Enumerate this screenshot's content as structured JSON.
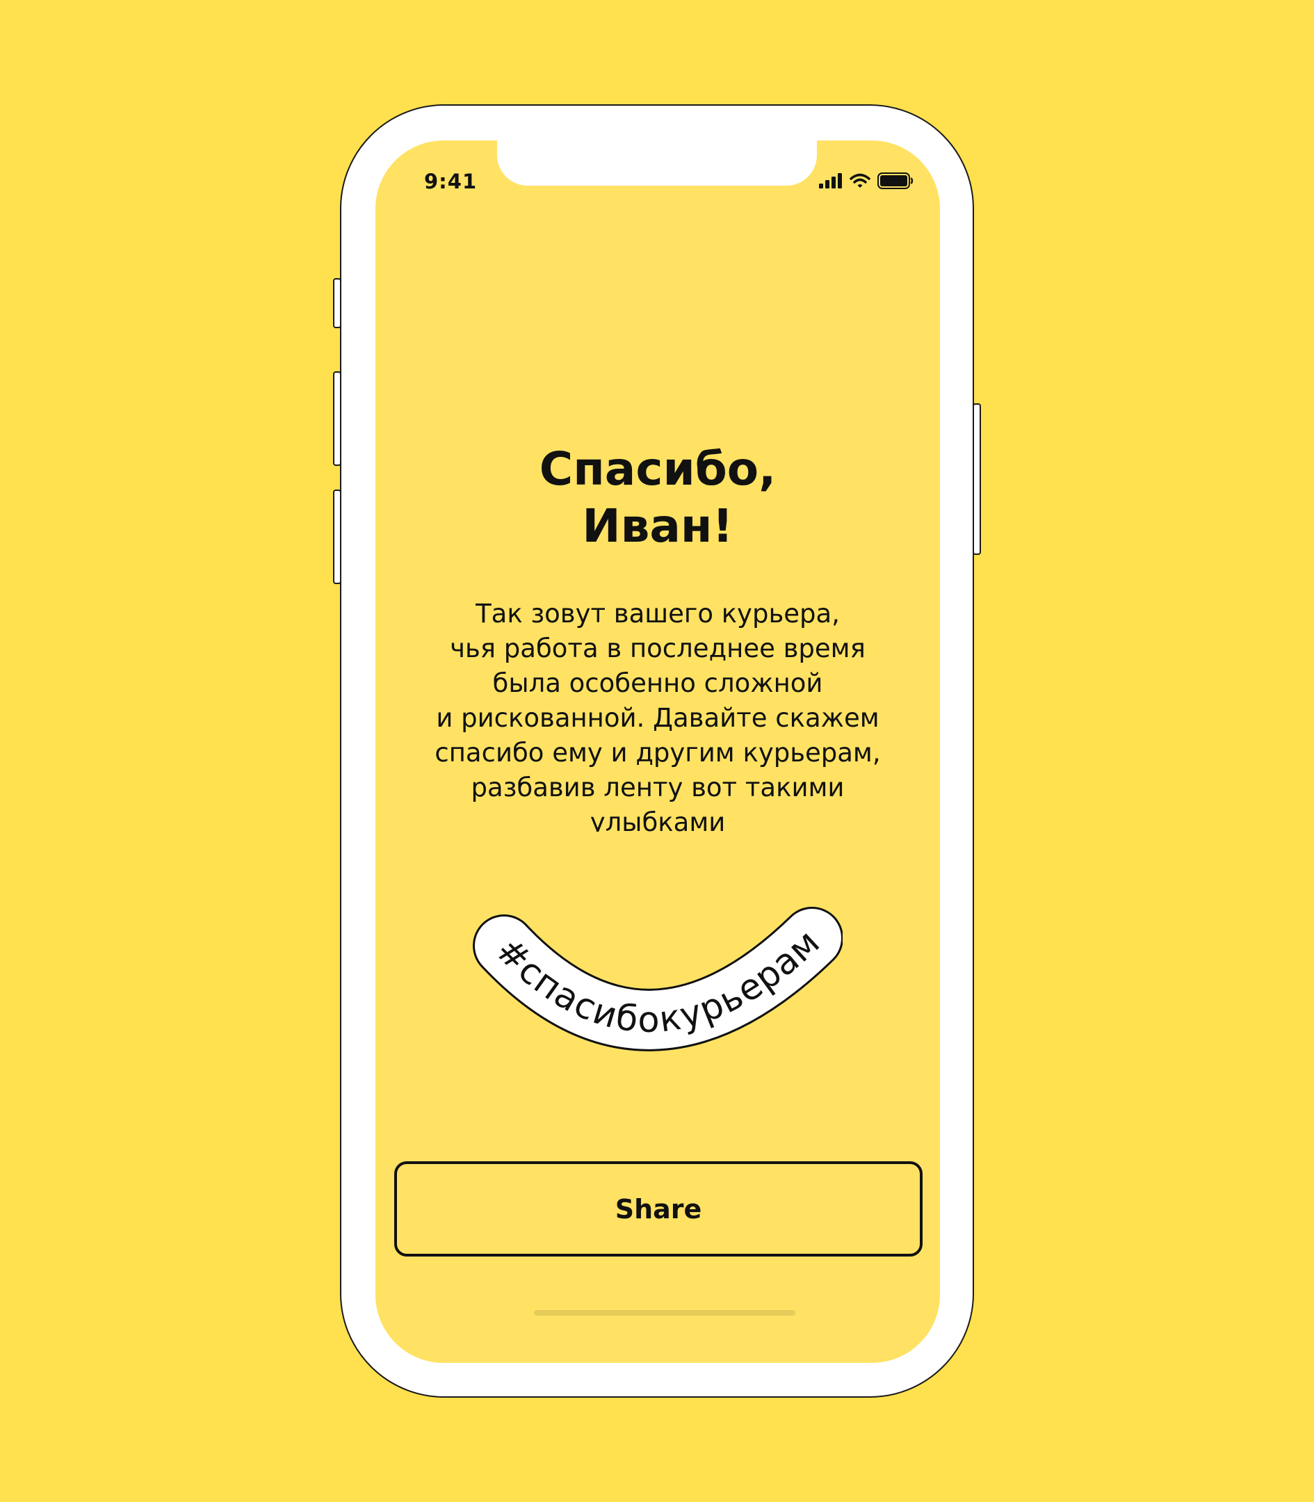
{
  "status_bar": {
    "time": "9:41",
    "icons": [
      "cellular-signal-icon",
      "wifi-icon",
      "battery-icon"
    ]
  },
  "content": {
    "title": "Спасибо,\nИван!",
    "body": "Так зовут вашего курьера,\nчья работа в последнее время\nбыла особенно сложной\nи рискованной. Давайте скажем\nспасибо ему и другим курьерам,\nразбавив ленту вот такими\nулыбками",
    "hashtag": "#спасибокурьерам"
  },
  "share_button": {
    "label": "Share"
  },
  "colors": {
    "background": "#FFE04E",
    "screen": "#FFE264",
    "text": "#111111",
    "badge_fill": "#FFFFFF"
  }
}
